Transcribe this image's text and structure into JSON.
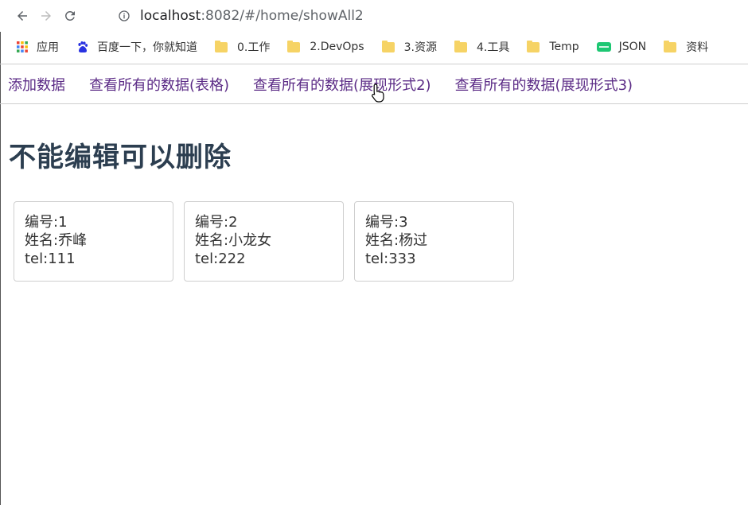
{
  "browser": {
    "url_host": "localhost",
    "url_rest": ":8082/#/home/showAll2",
    "bookmarks": [
      {
        "label": "应用",
        "icon": "apps-grid-icon"
      },
      {
        "label": "百度一下，你就知道",
        "icon": "baidu-icon"
      },
      {
        "label": "0.工作",
        "icon": "folder-icon"
      },
      {
        "label": "2.DevOps",
        "icon": "folder-icon"
      },
      {
        "label": "3.资源",
        "icon": "folder-icon"
      },
      {
        "label": "4.工具",
        "icon": "folder-icon"
      },
      {
        "label": "Temp",
        "icon": "folder-icon"
      },
      {
        "label": "JSON",
        "icon": "json-icon"
      },
      {
        "label": "资料",
        "icon": "folder-icon"
      }
    ]
  },
  "nav": {
    "links": [
      "添加数据",
      "查看所有的数据(表格)",
      "查看所有的数据(展现形式2)",
      "查看所有的数据(展现形式3)"
    ]
  },
  "page": {
    "title": "不能编辑可以删除"
  },
  "cards": [
    {
      "id_line": "编号:1",
      "name_line": "姓名:乔峰",
      "tel_line": "tel:111"
    },
    {
      "id_line": "编号:2",
      "name_line": "姓名:小龙女",
      "tel_line": "tel:222"
    },
    {
      "id_line": "编号:3",
      "name_line": "姓名:杨过",
      "tel_line": "tel:333"
    }
  ]
}
